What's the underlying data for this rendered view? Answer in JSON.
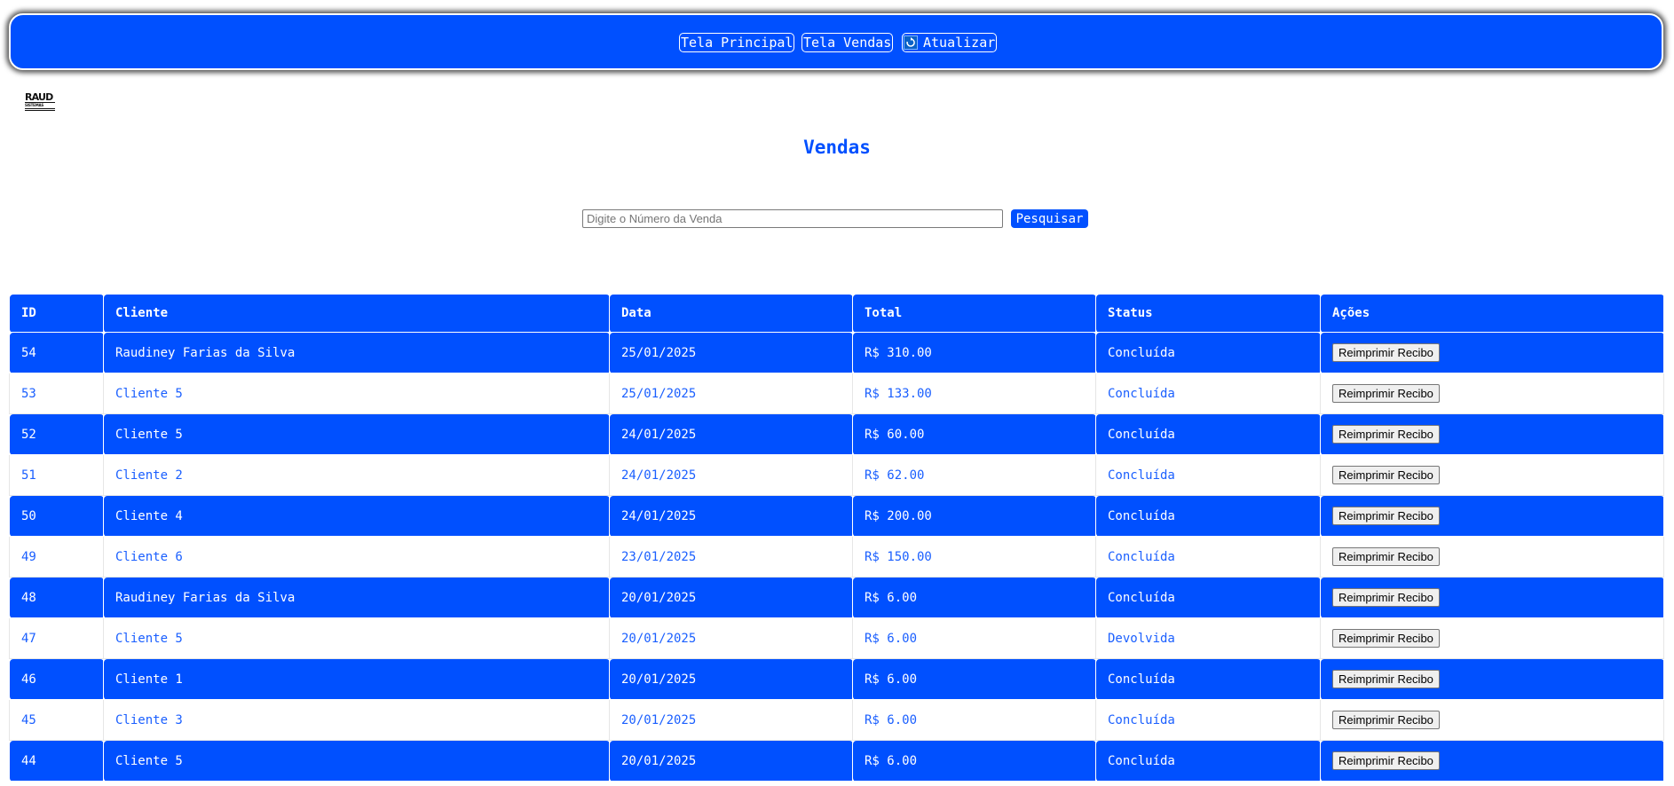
{
  "nav": {
    "main_screen_label": "Tela Principal",
    "sales_screen_label": "Tela Vendas",
    "refresh_label": "Atualizar",
    "refresh_icon": "refresh-icon"
  },
  "logo": {
    "main": "RAUD",
    "sub": "SISTEMAS"
  },
  "page": {
    "title": "Vendas"
  },
  "search": {
    "placeholder": "Digite o Número da Venda",
    "value": "",
    "button_label": "Pesquisar"
  },
  "table": {
    "headers": [
      "ID",
      "Cliente",
      "Data",
      "Total",
      "Status",
      "Ações"
    ],
    "action_label": "Reimprimir Recibo",
    "rows": [
      {
        "id": "54",
        "cliente": "Raudiney Farias da Silva",
        "data": "25/01/2025",
        "total": "R$ 310.00",
        "status": "Concluída"
      },
      {
        "id": "53",
        "cliente": "Cliente 5",
        "data": "25/01/2025",
        "total": "R$ 133.00",
        "status": "Concluída"
      },
      {
        "id": "52",
        "cliente": "Cliente 5",
        "data": "24/01/2025",
        "total": "R$ 60.00",
        "status": "Concluída"
      },
      {
        "id": "51",
        "cliente": "Cliente 2",
        "data": "24/01/2025",
        "total": "R$ 62.00",
        "status": "Concluída"
      },
      {
        "id": "50",
        "cliente": "Cliente 4",
        "data": "24/01/2025",
        "total": "R$ 200.00",
        "status": "Concluída"
      },
      {
        "id": "49",
        "cliente": "Cliente 6",
        "data": "23/01/2025",
        "total": "R$ 150.00",
        "status": "Concluída"
      },
      {
        "id": "48",
        "cliente": "Raudiney Farias da Silva",
        "data": "20/01/2025",
        "total": "R$ 6.00",
        "status": "Concluída"
      },
      {
        "id": "47",
        "cliente": "Cliente 5",
        "data": "20/01/2025",
        "total": "R$ 6.00",
        "status": "Devolvida"
      },
      {
        "id": "46",
        "cliente": "Cliente 1",
        "data": "20/01/2025",
        "total": "R$ 6.00",
        "status": "Concluída"
      },
      {
        "id": "45",
        "cliente": "Cliente 3",
        "data": "20/01/2025",
        "total": "R$ 6.00",
        "status": "Concluída"
      },
      {
        "id": "44",
        "cliente": "Cliente 5",
        "data": "20/01/2025",
        "total": "R$ 6.00",
        "status": "Concluída"
      }
    ]
  },
  "colors": {
    "primary": "#0050ff",
    "white": "#ffffff",
    "link_text": "#1a5fff"
  }
}
